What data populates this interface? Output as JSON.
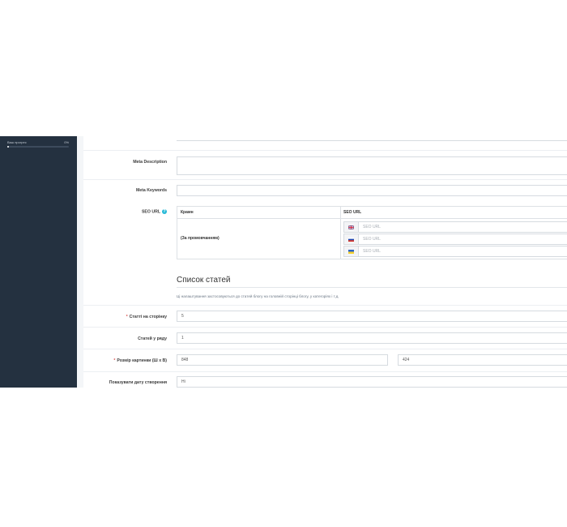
{
  "sidebar": {
    "progress": {
      "label": "Ваш прогрес",
      "percent_text": "0%",
      "value": 0
    }
  },
  "form": {
    "meta_description": {
      "label": "Meta Description",
      "value": ""
    },
    "meta_keywords": {
      "label": "Meta Keywords",
      "value": ""
    },
    "seo_url": {
      "label": "SEO URL",
      "table": {
        "col_store": "Крамн",
        "col_seo": "SEO URL",
        "store_name": "(За промовчанням)",
        "languages": [
          {
            "flag": "en-flag",
            "placeholder": "SEO URL"
          },
          {
            "flag": "ru-flag",
            "placeholder": "SEO URL"
          },
          {
            "flag": "ua-flag",
            "placeholder": "SEO URL"
          }
        ]
      }
    },
    "article_list": {
      "title": "Список статей",
      "help": "Ці налаштування застосовуються до статей блогу на головній сторінці блогу, у категоріях і т.д.",
      "per_page": {
        "label": "Статті на сторінку",
        "value": "5",
        "required": true
      },
      "per_row": {
        "label": "Статей у ряду",
        "value": "1"
      },
      "image_size": {
        "label": "Розмір картинки (Ш х В)",
        "width": "848",
        "height": "424",
        "required": true
      },
      "show_date": {
        "label": "Показувати дату створення",
        "value": "Ні"
      }
    }
  },
  "colors": {
    "sidebar_bg": "#243140",
    "accent": "#25b9d7",
    "required": "#d9534f"
  }
}
